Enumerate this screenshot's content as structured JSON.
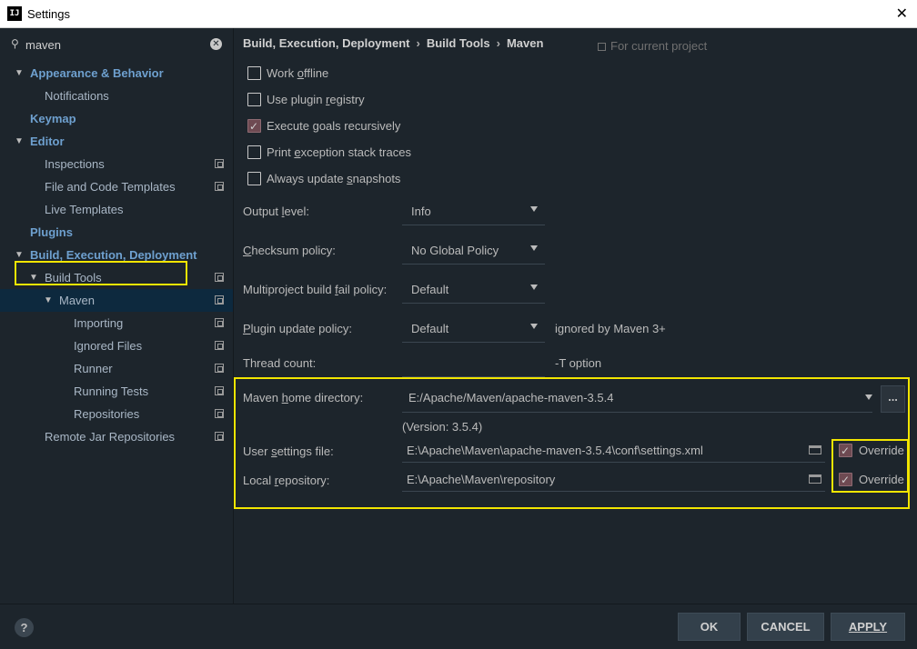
{
  "window": {
    "title": "Settings",
    "app_icon": "IJ"
  },
  "search": {
    "value": "maven",
    "placeholder": ""
  },
  "tree": [
    {
      "label": "Appearance & Behavior",
      "level": 0,
      "expanded": true,
      "bold": true
    },
    {
      "label": "Notifications",
      "level": 1
    },
    {
      "label": "Keymap",
      "level": 0,
      "bold": true
    },
    {
      "label": "Editor",
      "level": 0,
      "expanded": true,
      "bold": true
    },
    {
      "label": "Inspections",
      "level": 1,
      "project": true
    },
    {
      "label": "File and Code Templates",
      "level": 1,
      "project": true
    },
    {
      "label": "Live Templates",
      "level": 1
    },
    {
      "label": "Plugins",
      "level": 0,
      "bold": true
    },
    {
      "label": "Build, Execution, Deployment",
      "level": 0,
      "expanded": true,
      "bold": true
    },
    {
      "label": "Build Tools",
      "level": 1,
      "expanded": true,
      "project": true
    },
    {
      "label": "Maven",
      "level": 2,
      "expanded": true,
      "project": true,
      "selected": true
    },
    {
      "label": "Importing",
      "level": 3,
      "project": true
    },
    {
      "label": "Ignored Files",
      "level": 3,
      "project": true
    },
    {
      "label": "Runner",
      "level": 3,
      "project": true
    },
    {
      "label": "Running Tests",
      "level": 3,
      "project": true
    },
    {
      "label": "Repositories",
      "level": 3,
      "project": true
    },
    {
      "label": "Remote Jar Repositories",
      "level": 1,
      "project": true
    }
  ],
  "breadcrumb": {
    "part1": "Build, Execution, Deployment",
    "part2": "Build Tools",
    "part3": "Maven",
    "sep": "›"
  },
  "for_current_project": "For current project",
  "checkboxes": [
    {
      "label": "Work offline",
      "checked": false
    },
    {
      "label": "Use plugin registry",
      "checked": false
    },
    {
      "label": "Execute goals recursively",
      "checked": true
    },
    {
      "label": "Print exception stack traces",
      "checked": false
    },
    {
      "label": "Always update snapshots",
      "checked": false
    }
  ],
  "fields": {
    "output_level": {
      "label": "Output level:",
      "value": "Info"
    },
    "checksum_policy": {
      "label": "Checksum policy:",
      "value": "No Global Policy"
    },
    "multiproject_fail": {
      "label": "Multiproject build fail policy:",
      "value": "Default"
    },
    "plugin_update": {
      "label": "Plugin update policy:",
      "value": "Default",
      "hint": "ignored by Maven 3+"
    },
    "thread_count": {
      "label": "Thread count:",
      "hint": "-T option"
    },
    "maven_home": {
      "label": "Maven home directory:",
      "value": "E:/Apache/Maven/apache-maven-3.5.4",
      "version": "(Version: 3.5.4)",
      "browse": "..."
    },
    "user_settings": {
      "label": "User settings file:",
      "value": "E:\\Apache\\Maven\\apache-maven-3.5.4\\conf\\settings.xml",
      "override_label": "Override",
      "override": true
    },
    "local_repo": {
      "label": "Local repository:",
      "value": "E:\\Apache\\Maven\\repository",
      "override_label": "Override",
      "override": true
    }
  },
  "buttons": {
    "ok": "OK",
    "cancel": "CANCEL",
    "apply": "APPLY",
    "help": "?"
  },
  "colors": {
    "background": "#1d252c",
    "highlight": "#f2e500",
    "selected_row": "#0d293e",
    "bold_label": "#6ea0cf"
  }
}
